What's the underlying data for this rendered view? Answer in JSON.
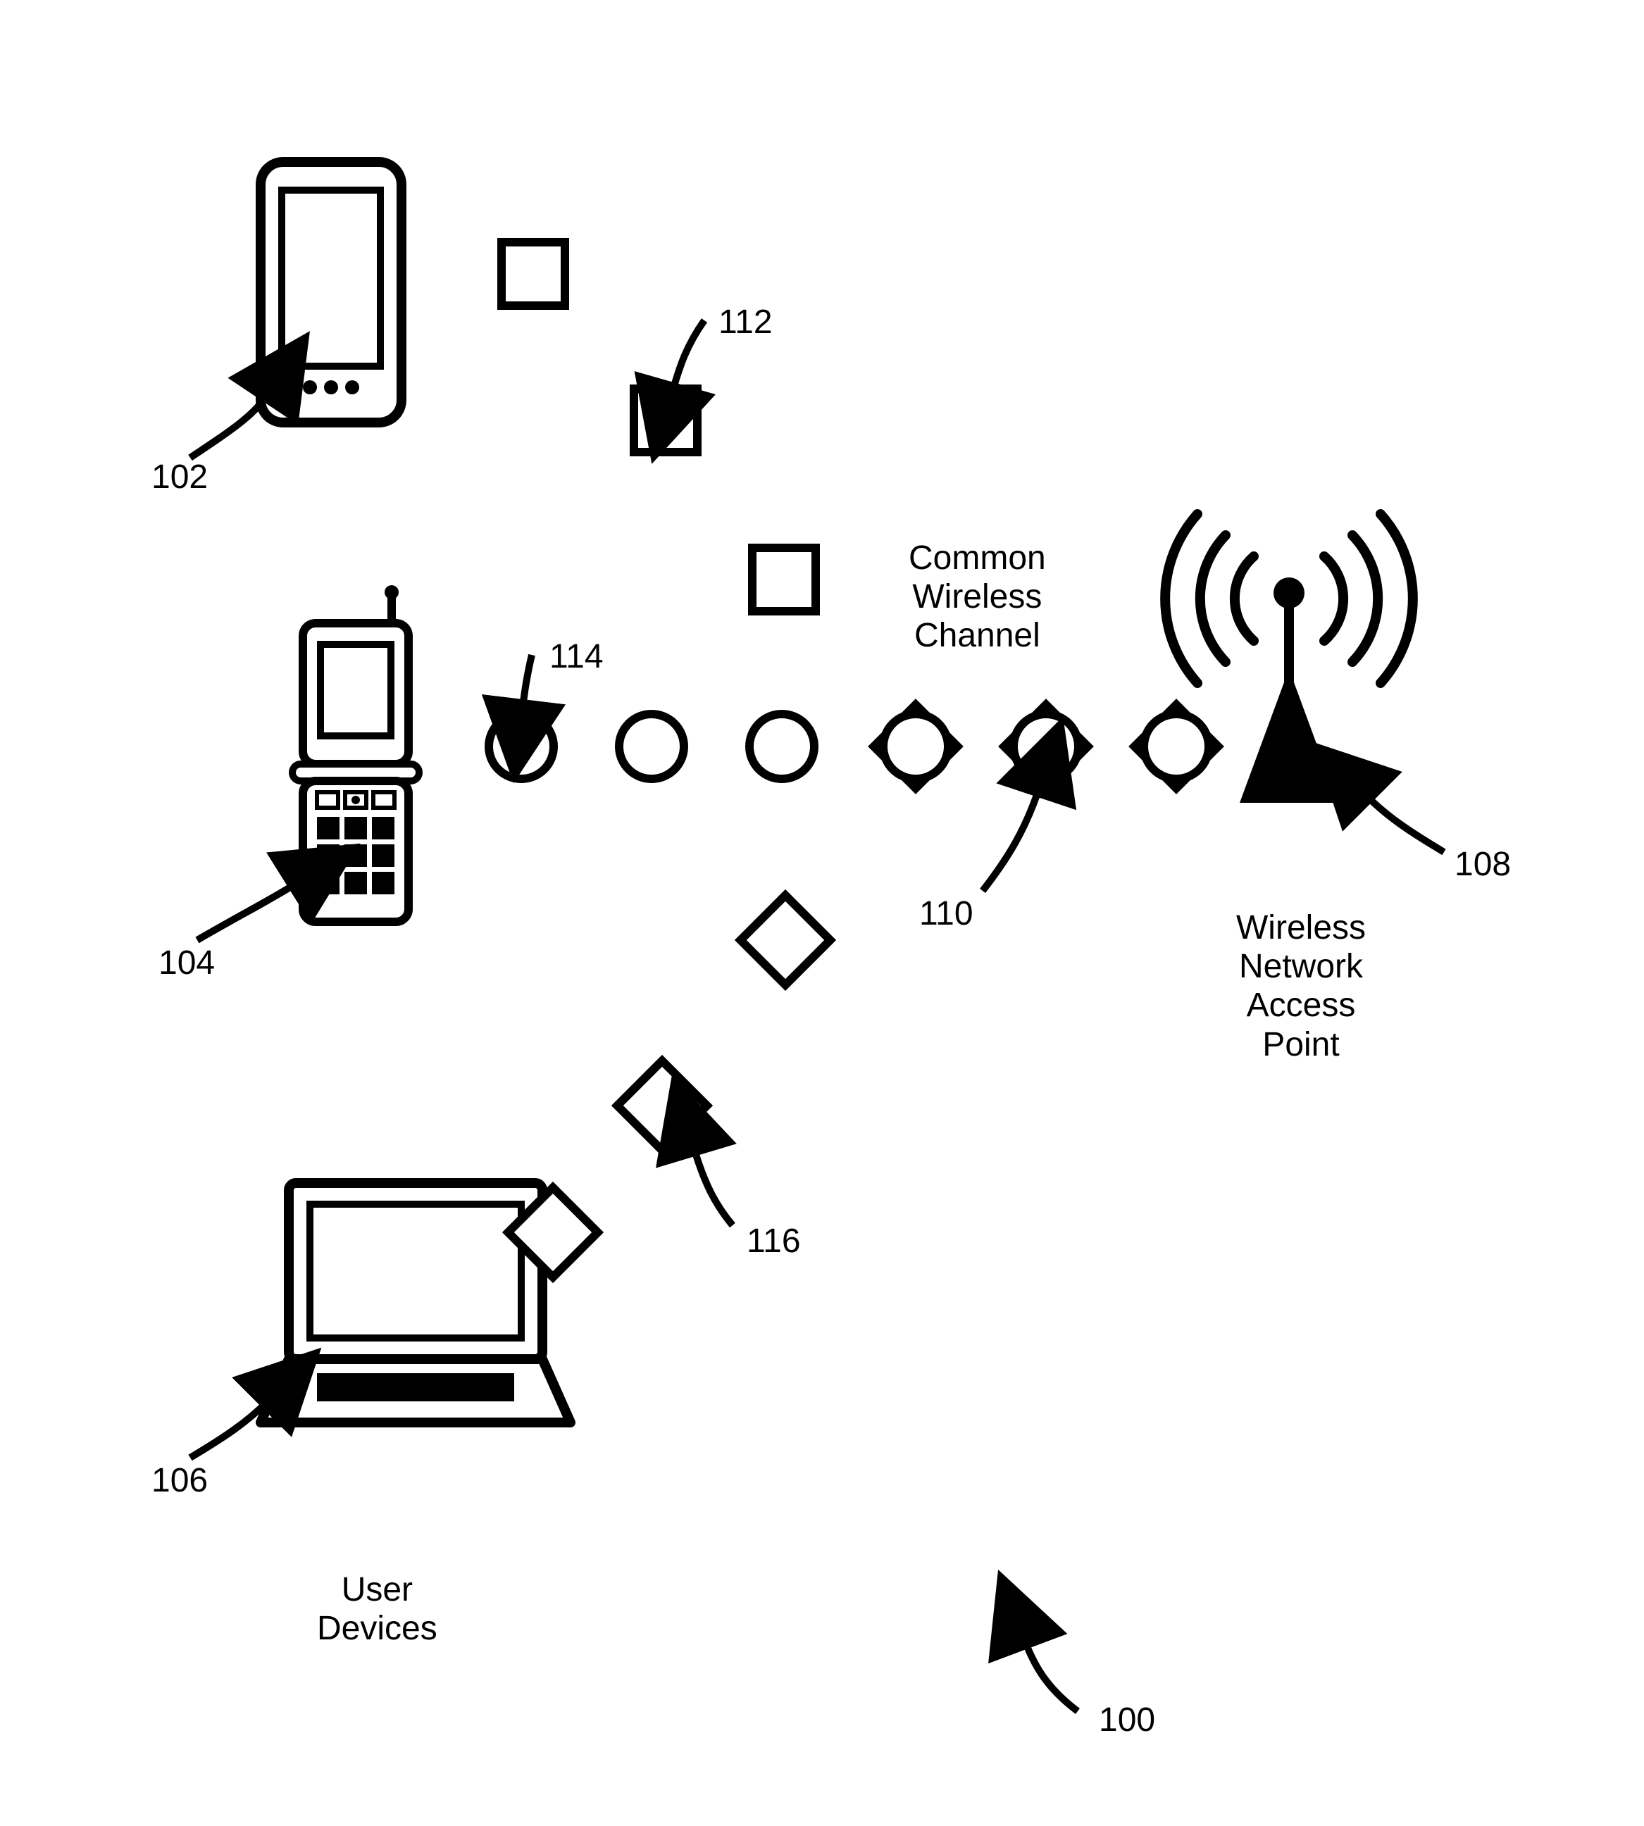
{
  "labels": {
    "ref100": "100",
    "ref102": "102",
    "ref104": "104",
    "ref106": "106",
    "ref108": "108",
    "ref110": "110",
    "ref112": "112",
    "ref114": "114",
    "ref116": "116",
    "commonWirelessChannel": "Common\nWireless\nChannel",
    "wirelessNetworkAccessPoint": "Wireless\nNetwork\nAccess\nPoint",
    "userDevices": "User\nDevices"
  },
  "elements": {
    "smartphone": {
      "ref": "102",
      "type": "device"
    },
    "flipPhone": {
      "ref": "104",
      "type": "device"
    },
    "laptop": {
      "ref": "106",
      "type": "device"
    },
    "accessPoint": {
      "ref": "108",
      "type": "networkNode"
    },
    "combinedSymbol": {
      "ref": "110",
      "type": "channelSymbol",
      "shape": "circle+square"
    },
    "squareSymbol": {
      "ref": "112",
      "type": "channelSymbol",
      "shape": "square"
    },
    "circleSymbol": {
      "ref": "114",
      "type": "channelSymbol",
      "shape": "circle"
    },
    "diamondSymbol": {
      "ref": "116",
      "type": "channelSymbol",
      "shape": "diamond"
    }
  }
}
